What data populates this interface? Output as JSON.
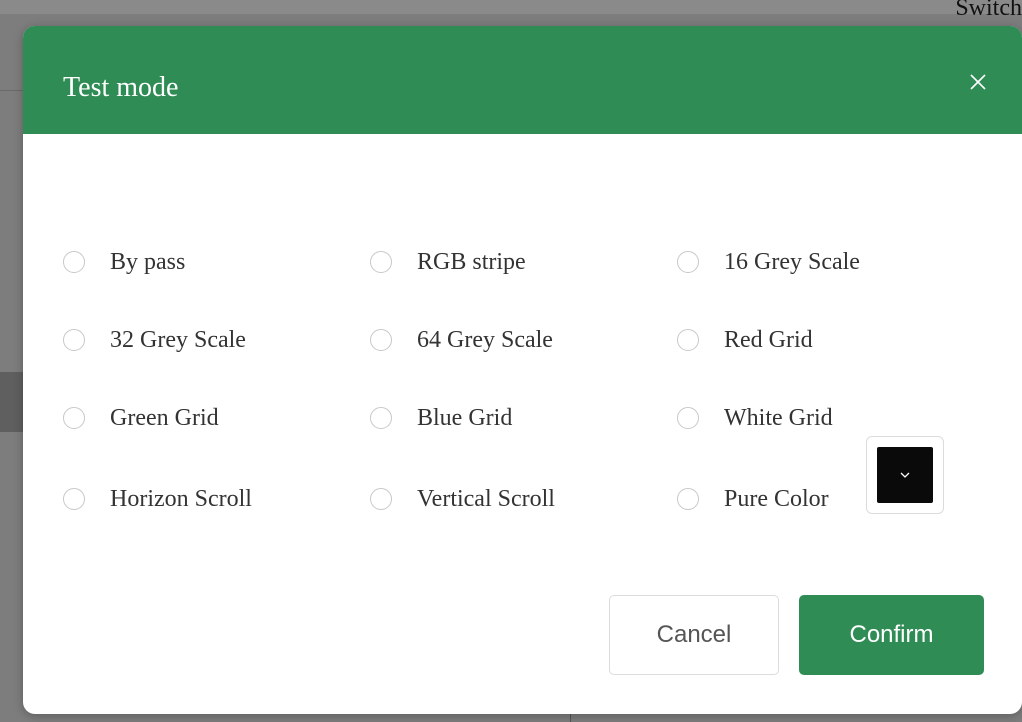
{
  "background": {
    "partial_text": "Switch"
  },
  "dialog": {
    "title": "Test mode",
    "close_label": "×",
    "header_color": "#2f8c55"
  },
  "options": [
    {
      "label": "By pass",
      "selected": false
    },
    {
      "label": "RGB stripe",
      "selected": false
    },
    {
      "label": "16 Grey Scale",
      "selected": false
    },
    {
      "label": "32 Grey Scale",
      "selected": false
    },
    {
      "label": "64 Grey Scale",
      "selected": false
    },
    {
      "label": "Red Grid",
      "selected": false
    },
    {
      "label": "Green Grid",
      "selected": false
    },
    {
      "label": "Blue Grid",
      "selected": false
    },
    {
      "label": "White Grid",
      "selected": false
    },
    {
      "label": "Horizon Scroll",
      "selected": false
    },
    {
      "label": "Vertical Scroll",
      "selected": false
    },
    {
      "label": "Pure Color",
      "selected": false
    }
  ],
  "pure_color": {
    "value": "#0a0a0a",
    "icon": "chevron-down-icon"
  },
  "buttons": {
    "cancel": "Cancel",
    "confirm": "Confirm"
  }
}
